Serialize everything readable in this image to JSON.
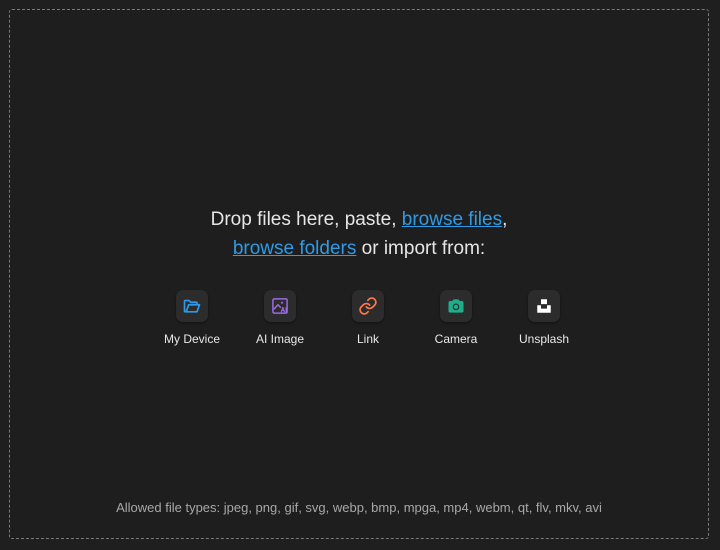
{
  "dropzone": {
    "prompt_part1": "Drop files here, paste, ",
    "browse_files_link": "browse files",
    "prompt_comma": ",",
    "browse_folders_link": "browse folders",
    "prompt_part2": " or import from:"
  },
  "sources": [
    {
      "label": "My Device",
      "icon": "folder-open-icon",
      "color": "#2f9be6"
    },
    {
      "label": "AI Image",
      "icon": "ai-image-icon",
      "color": "#9b6be0"
    },
    {
      "label": "Link",
      "icon": "link-icon",
      "color": "#ff7a4d"
    },
    {
      "label": "Camera",
      "icon": "camera-icon",
      "color": "#1fae8a"
    },
    {
      "label": "Unsplash",
      "icon": "unsplash-icon",
      "color": "#ffffff"
    }
  ],
  "allowed_types": "Allowed file types: jpeg, png, gif, svg, webp, bmp, mpga, mp4, webm, qt, flv, mkv, avi",
  "colors": {
    "background": "#1f1f1f",
    "link": "#2f9be6",
    "text": "#e6e6e6",
    "muted": "#a8a8a8"
  }
}
